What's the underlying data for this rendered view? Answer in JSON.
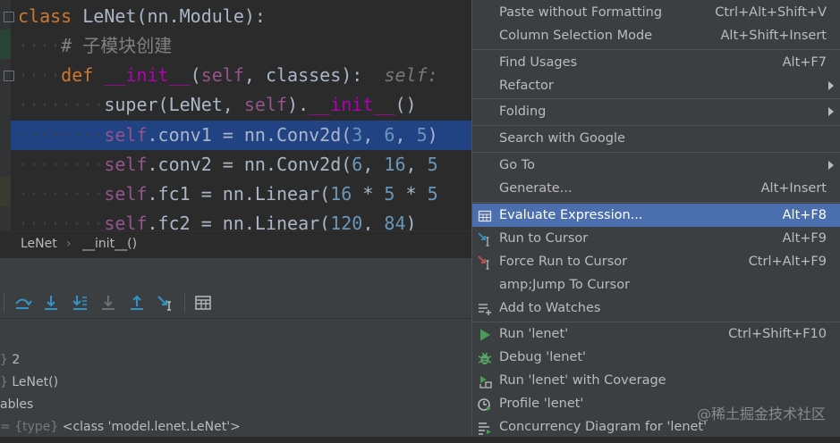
{
  "editor": {
    "lines": [
      {
        "id": "l1",
        "parts": [
          {
            "t": "class ",
            "c": "kw"
          },
          {
            "t": "LeNet(nn.Module):",
            "c": ""
          }
        ]
      },
      {
        "id": "l2",
        "parts": [
          {
            "t": "····",
            "c": "guide"
          },
          {
            "t": "# 子模块创建",
            "c": "cmt"
          }
        ]
      },
      {
        "id": "l3",
        "parts": [
          {
            "t": "····",
            "c": "guide"
          },
          {
            "t": "def ",
            "c": "kw"
          },
          {
            "t": "__init__",
            "c": "mg"
          },
          {
            "t": "(",
            "c": ""
          },
          {
            "t": "self",
            "c": "sf"
          },
          {
            "t": ", classes):  ",
            "c": ""
          },
          {
            "t": "self:",
            "c": "hint"
          }
        ]
      },
      {
        "id": "l4",
        "parts": [
          {
            "t": "········",
            "c": "guide"
          },
          {
            "t": "super",
            "c": ""
          },
          {
            "t": "(LeNet, ",
            "c": ""
          },
          {
            "t": "self",
            "c": "sf"
          },
          {
            "t": ").",
            "c": ""
          },
          {
            "t": "__init__",
            "c": "mg"
          },
          {
            "t": "()",
            "c": ""
          }
        ]
      },
      {
        "id": "l5",
        "parts": [
          {
            "t": "········",
            "c": "guide"
          },
          {
            "t": "self",
            "c": "sf"
          },
          {
            "t": ".conv1 = nn.Conv2d(",
            "c": ""
          },
          {
            "t": "3",
            "c": "num"
          },
          {
            "t": ", ",
            "c": ""
          },
          {
            "t": "6",
            "c": "num"
          },
          {
            "t": ", ",
            "c": ""
          },
          {
            "t": "5",
            "c": "num"
          },
          {
            "t": ")",
            "c": ""
          }
        ]
      },
      {
        "id": "l6",
        "parts": [
          {
            "t": "········",
            "c": "guide"
          },
          {
            "t": "self",
            "c": "sf"
          },
          {
            "t": ".conv2 = nn.Conv2d(",
            "c": ""
          },
          {
            "t": "6",
            "c": "num"
          },
          {
            "t": ", ",
            "c": ""
          },
          {
            "t": "16",
            "c": "num"
          },
          {
            "t": ", ",
            "c": ""
          },
          {
            "t": "5",
            "c": "num"
          }
        ]
      },
      {
        "id": "l7",
        "parts": [
          {
            "t": "········",
            "c": "guide"
          },
          {
            "t": "self",
            "c": "sf"
          },
          {
            "t": ".fc1 = nn.Linear(",
            "c": ""
          },
          {
            "t": "16",
            "c": "num"
          },
          {
            "t": " * ",
            "c": ""
          },
          {
            "t": "5",
            "c": "num"
          },
          {
            "t": " * ",
            "c": ""
          },
          {
            "t": "5",
            "c": "num"
          }
        ]
      },
      {
        "id": "l8",
        "parts": [
          {
            "t": "········",
            "c": "guide"
          },
          {
            "t": "self",
            "c": "sf"
          },
          {
            "t": ".fc2 = nn.Linear(",
            "c": ""
          },
          {
            "t": "120",
            "c": "num"
          },
          {
            "t": ", ",
            "c": ""
          },
          {
            "t": "84",
            "c": "num"
          },
          {
            "t": ")",
            "c": ""
          }
        ]
      }
    ]
  },
  "breadcrumb": {
    "class_name": "LeNet",
    "separator": "›",
    "method": "__init__()"
  },
  "variables": [
    {
      "prefix": "} ",
      "value": "2"
    },
    {
      "prefix": "} ",
      "value": "LeNet()"
    },
    {
      "prefix": "",
      "value": "ables"
    },
    {
      "prefix": "= ",
      "type": "{type}",
      "value": "<class 'model.lenet.LeNet'>"
    }
  ],
  "toolbar": {
    "icons": [
      "step-over-icon",
      "step-into-icon",
      "step-into-my-code-icon",
      "force-step-into-icon",
      "step-out-icon",
      "run-to-cursor-icon",
      "evaluate-expression-icon"
    ]
  },
  "menu": {
    "items": [
      {
        "label": "Paste without Formatting",
        "shortcut": "Ctrl+Alt+Shift+V"
      },
      {
        "label": "Column Selection Mode",
        "shortcut": "Alt+Shift+Insert"
      },
      {
        "label": "Find Usages",
        "shortcut": "Alt+F7"
      },
      {
        "label": "Refactor",
        "shortcut": ""
      },
      {
        "label": "Folding",
        "shortcut": ""
      },
      {
        "label": "Search with Google",
        "shortcut": ""
      },
      {
        "label": "Go To",
        "shortcut": ""
      },
      {
        "label": "Generate...",
        "shortcut": "Alt+Insert"
      },
      {
        "label": "Evaluate Expression...",
        "shortcut": "Alt+F8"
      },
      {
        "label": "Run to Cursor",
        "shortcut": "Alt+F9"
      },
      {
        "label": "Force Run to Cursor",
        "shortcut": "Ctrl+Alt+F9"
      },
      {
        "label": "amp;Jump To Cursor",
        "shortcut": ""
      },
      {
        "label": "Add to Watches",
        "shortcut": ""
      },
      {
        "label": "Run 'lenet'",
        "shortcut": "Ctrl+Shift+F10"
      },
      {
        "label": "Debug 'lenet'",
        "shortcut": ""
      },
      {
        "label": "Run 'lenet' with Coverage",
        "shortcut": ""
      },
      {
        "label": "Profile 'lenet'",
        "shortcut": ""
      },
      {
        "label": "Concurrency Diagram for 'lenet'",
        "shortcut": ""
      }
    ]
  },
  "watermark": "@稀土掘金技术社区",
  "colors": {
    "selection": "#4b6eaf",
    "editor_highlight": "#214283",
    "run_green": "#499c54",
    "debug_green": "#59a869"
  }
}
